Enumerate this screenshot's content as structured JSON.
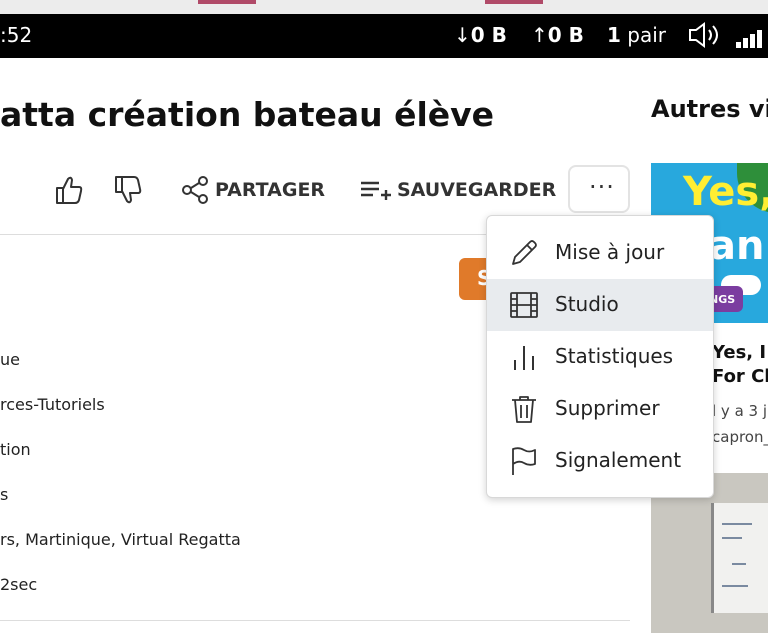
{
  "status_bar": {
    "time": ":52",
    "download": "0 B",
    "upload": "0 B",
    "peers_count": "1",
    "peers_label": "pair"
  },
  "video": {
    "title": "atta création bateau élève"
  },
  "actions": {
    "share": "PARTAGER",
    "save": "SAUVEGARDER",
    "more": "···"
  },
  "subscribe_partial": "S",
  "details": [
    "ue",
    "rces-Tutoriels",
    "tion",
    "s",
    "rs, Martinique, Virtual Regatta",
    "2sec"
  ],
  "dropdown_menu": {
    "items": [
      {
        "label": "Mise à jour",
        "icon": "pencil-icon"
      },
      {
        "label": "Studio",
        "icon": "film-icon"
      },
      {
        "label": "Statistiques",
        "icon": "bar-chart-icon"
      },
      {
        "label": "Supprimer",
        "icon": "trash-icon"
      },
      {
        "label": "Signalement",
        "icon": "flag-icon"
      }
    ],
    "active_index": 1
  },
  "sidebar": {
    "heading": "Autres vid",
    "videos": [
      {
        "thumb_text_top": "Yes,",
        "thumb_text_bottom": "an!",
        "thumb_badge": "NGS",
        "title_line1": "Yes, I C",
        "title_line2": "For Ch",
        "age": "l y a 3 j",
        "channel": "capron_"
      }
    ]
  },
  "colors": {
    "accent_orange": "#e07a2a",
    "status_bar_bg": "#000000",
    "menu_active_bg": "#e8ebee"
  }
}
